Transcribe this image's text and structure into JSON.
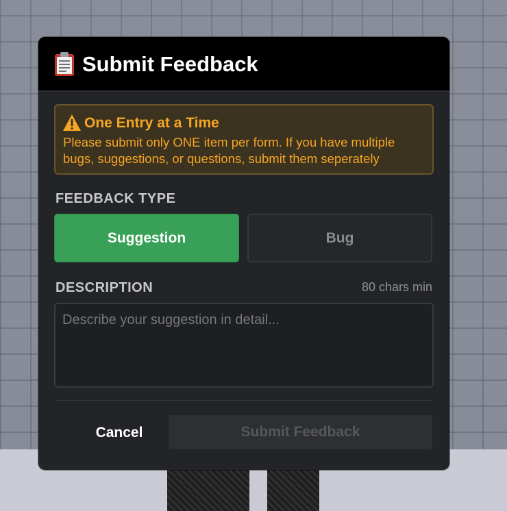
{
  "modal": {
    "title": "Submit Feedback",
    "title_icon": "clipboard-icon"
  },
  "warning": {
    "icon": "warning-icon",
    "title": "One Entry at a Time",
    "text": "Please submit only ONE item per form. If you have multiple bugs, suggestions, or questions, submit them seperately",
    "color": "#f5a623"
  },
  "feedback_type": {
    "label": "FEEDBACK TYPE",
    "options": [
      "Suggestion",
      "Bug"
    ],
    "selected": "Suggestion",
    "selected_color": "#38a157"
  },
  "description": {
    "label": "DESCRIPTION",
    "hint": "80 chars min",
    "value": "",
    "placeholder": "Describe your suggestion in detail..."
  },
  "actions": {
    "cancel_label": "Cancel",
    "submit_label": "Submit Feedback"
  }
}
